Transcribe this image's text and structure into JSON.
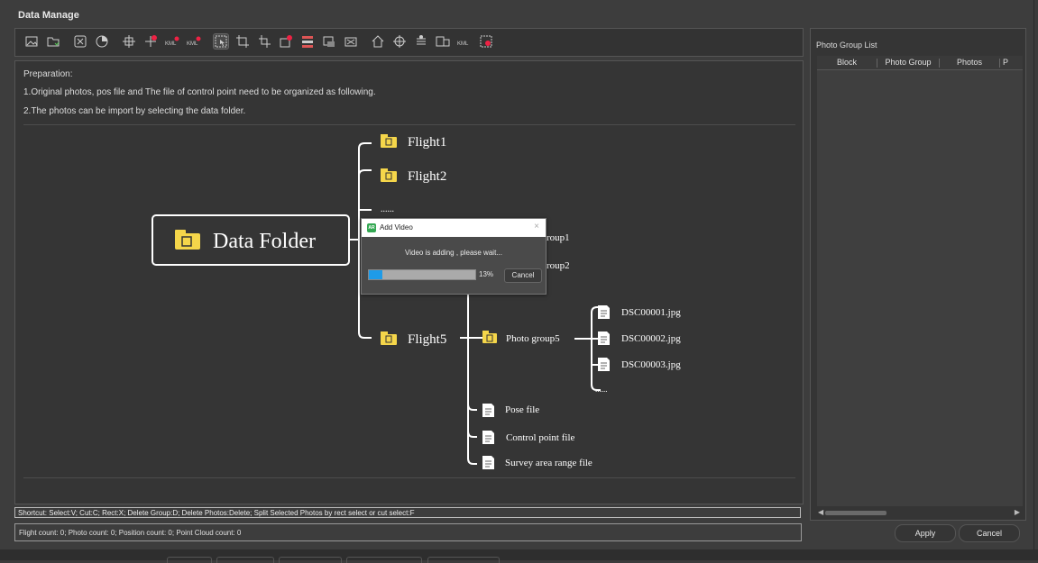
{
  "window": {
    "title": "Data Manage"
  },
  "toolbar": {
    "icons": [
      "import-photos-icon",
      "import-folder-icon",
      "import-pos-icon",
      "pie-stat-icon",
      "control-point-icon",
      "add-point-icon",
      "kml-import-icon",
      "kml-export-icon",
      "select-icon",
      "crop-icon",
      "cut-icon",
      "delete-group-icon",
      "split-icon",
      "merge-icon",
      "flip-icon",
      "home-icon",
      "target-icon",
      "layers-icon",
      "compare-icon",
      "kml-range-icon",
      "settings-icon"
    ]
  },
  "preparation": {
    "heading": "Preparation:",
    "line1": "1.Original photos, pos file and The file of control point need to be organized as following.",
    "line2": "2.The photos can be import by selecting the data folder."
  },
  "diagram": {
    "root": "Data Folder",
    "flight1": "Flight1",
    "flight2": "Flight2",
    "dots_flight": "......",
    "group1_partial": "roup1",
    "group2_partial": "roup2",
    "flight5": "Flight5",
    "photo_group5": "Photo group5",
    "file1": "DSC00001.jpg",
    "file2": "DSC00002.jpg",
    "file3": "DSC00003.jpg",
    "dots_files": "......",
    "pose_file": "Pose file",
    "control_point_file": "Control point file",
    "survey_file": "Survey area range file"
  },
  "dialog": {
    "title": "Add Video",
    "logo": "AR",
    "message": "Video is adding , please wait...",
    "progress": 0.13,
    "progress_label": "13%",
    "cancel": "Cancel"
  },
  "status": {
    "shortcut": "Shortcut: Select:V; Cut:C; Rect:X; Delete Group:D; Delete Photos:Delete; Split Selected Photos by rect select or cut select:F",
    "counts": "Flight count: 0; Photo count: 0; Position count: 0; Point Cloud count: 0"
  },
  "photo_group_list": {
    "label": "Photo Group List",
    "columns": [
      "Block",
      "Photo Group",
      "Photos",
      "P"
    ]
  },
  "buttons": {
    "apply": "Apply",
    "cancel": "Cancel"
  },
  "colors": {
    "folder": "#f5d64a",
    "progress": "#1e9be8",
    "panel": "#353535"
  }
}
